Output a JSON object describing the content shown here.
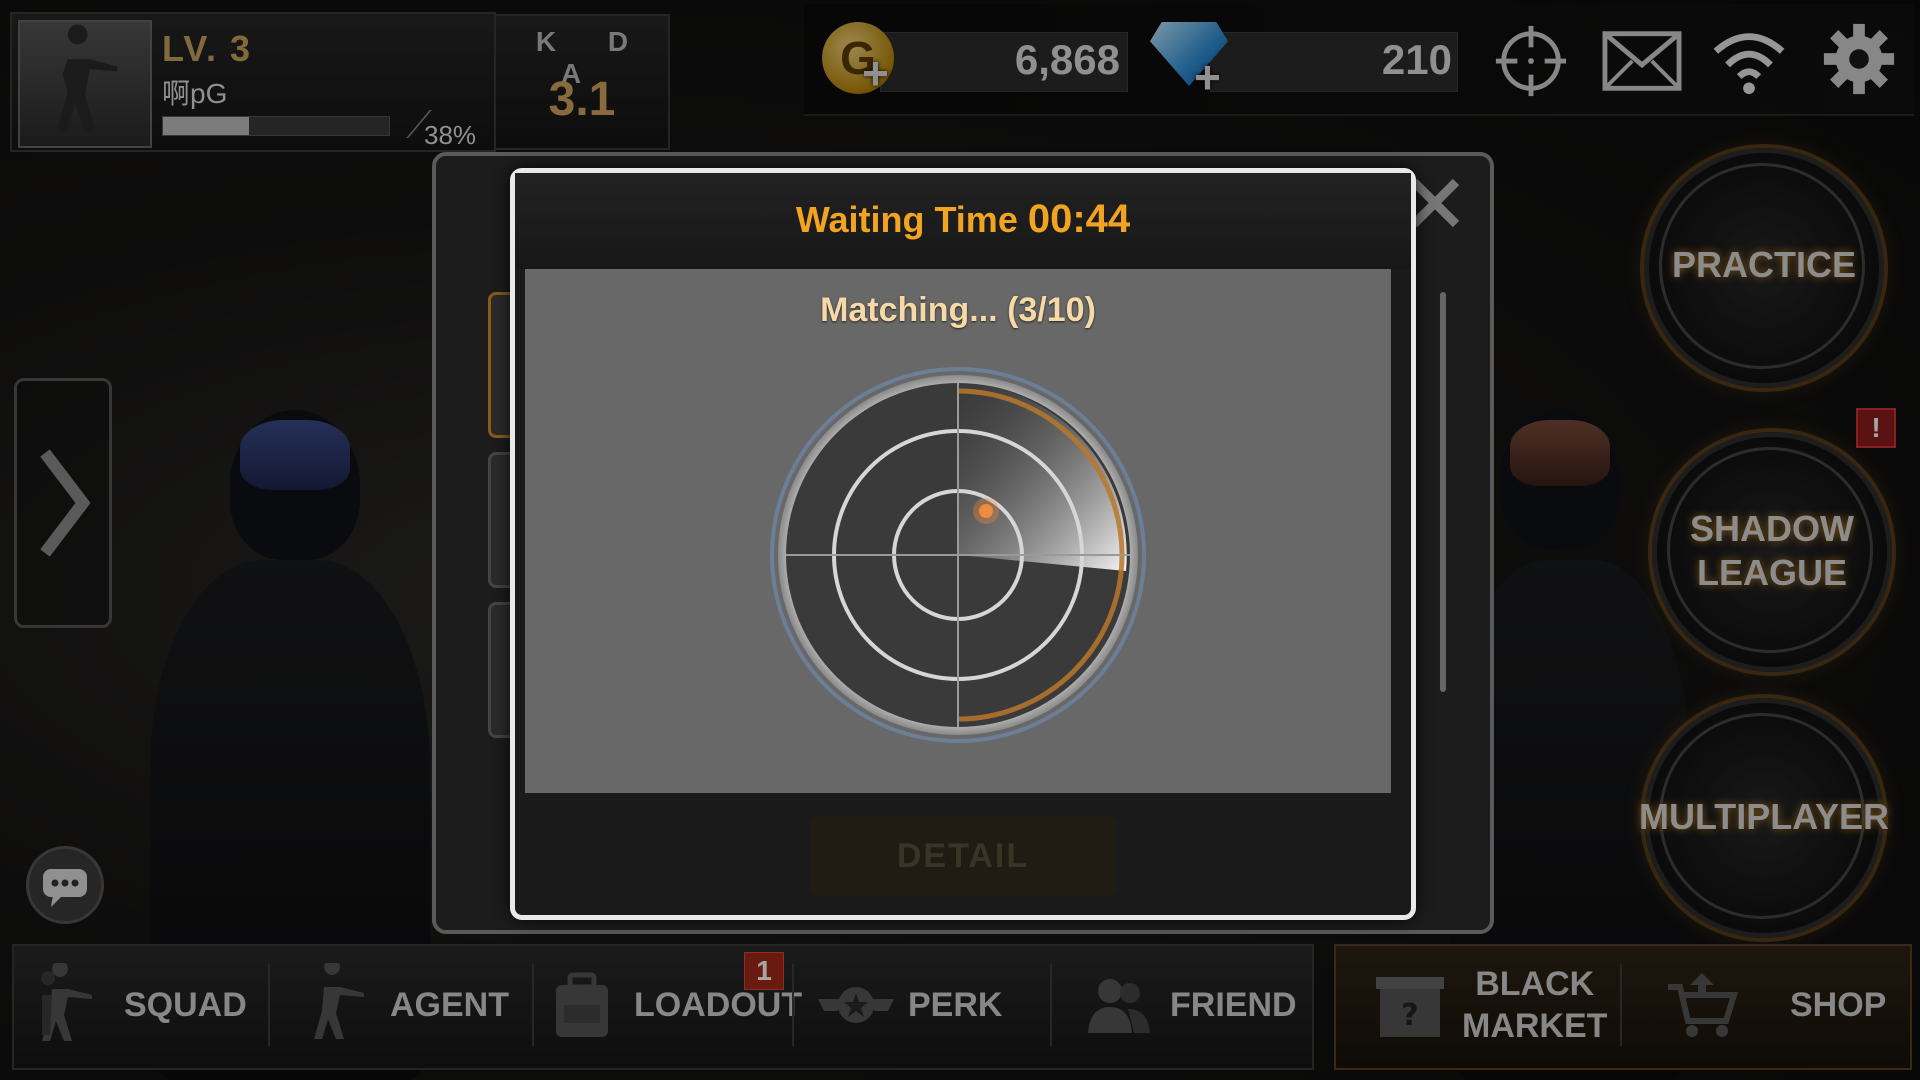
{
  "profile": {
    "level_label": "LV. 3",
    "player_name": "啊pG",
    "xp_percent_label": "38%",
    "xp_fraction": 0.38
  },
  "kda": {
    "label": "K D A",
    "value": "3.1"
  },
  "currency": {
    "gold_icon_letter": "G",
    "gold_value": "6,868",
    "gems_value": "210"
  },
  "hud_icons": [
    "crosshair-icon",
    "mail-icon",
    "wifi-icon",
    "settings-gear-icon"
  ],
  "modes": [
    {
      "name": "practice",
      "label": "PRACTICE"
    },
    {
      "name": "shadow-league",
      "label": "SHADOW\nLEAGUE"
    },
    {
      "name": "multiplayer",
      "label": "MULTIPLAYER"
    }
  ],
  "alert_badge": "!",
  "nav": {
    "squad": "SQUAD",
    "agent": "AGENT",
    "loadout": "LOADOUT",
    "loadout_badge": "1",
    "perk": "PERK",
    "friend": "FRIEND",
    "black_market": "BLACK\nMARKET",
    "shop": "SHOP"
  },
  "dialog": {
    "waiting_label": "Waiting Time",
    "waiting_time": "00:44",
    "matching_text": "Matching... (3/10)",
    "detail_button": "DETAIL"
  },
  "colors": {
    "accent_orange": "#f0a422",
    "gold_text": "#d1a45e",
    "dialog_body": "#686868"
  }
}
